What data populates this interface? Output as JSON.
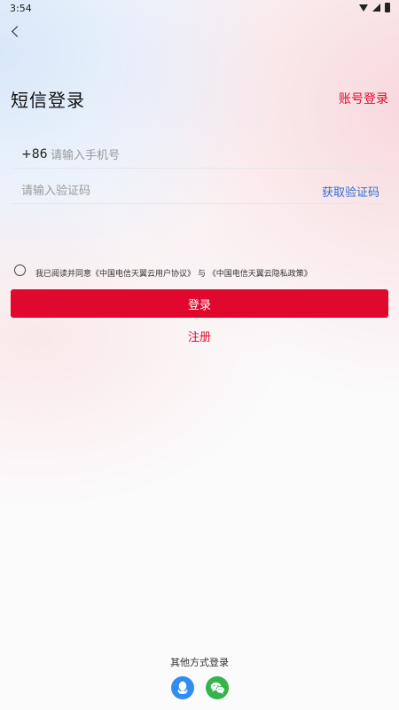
{
  "status_bar": {
    "time": "3:54",
    "icons": [
      "wifi-icon",
      "signal-icon",
      "battery-icon"
    ]
  },
  "header": {
    "back_icon": "chevron-left-icon",
    "title": "短信登录",
    "account_login_label": "账号登录"
  },
  "form": {
    "country_code": "+86",
    "phone_placeholder": "请输入手机号",
    "phone_value": "",
    "code_placeholder": "请输入验证码",
    "code_value": "",
    "get_code_label": "获取验证码"
  },
  "agreement": {
    "checked": false,
    "prefix": "我已阅读并同意",
    "user_agreement": "《中国电信天翼云用户协议》",
    "conjunction": "与",
    "privacy_policy": "《中国电信天翼云隐私政策》"
  },
  "actions": {
    "login_label": "登录",
    "register_label": "注册"
  },
  "other_login": {
    "title": "其他方式登录",
    "methods": [
      {
        "icon": "qq-icon",
        "color": "#2f8ef0"
      },
      {
        "icon": "wechat-icon",
        "color": "#34b44a"
      }
    ]
  },
  "colors": {
    "accent": "#e0082d",
    "link_blue": "#2f6fd6"
  }
}
